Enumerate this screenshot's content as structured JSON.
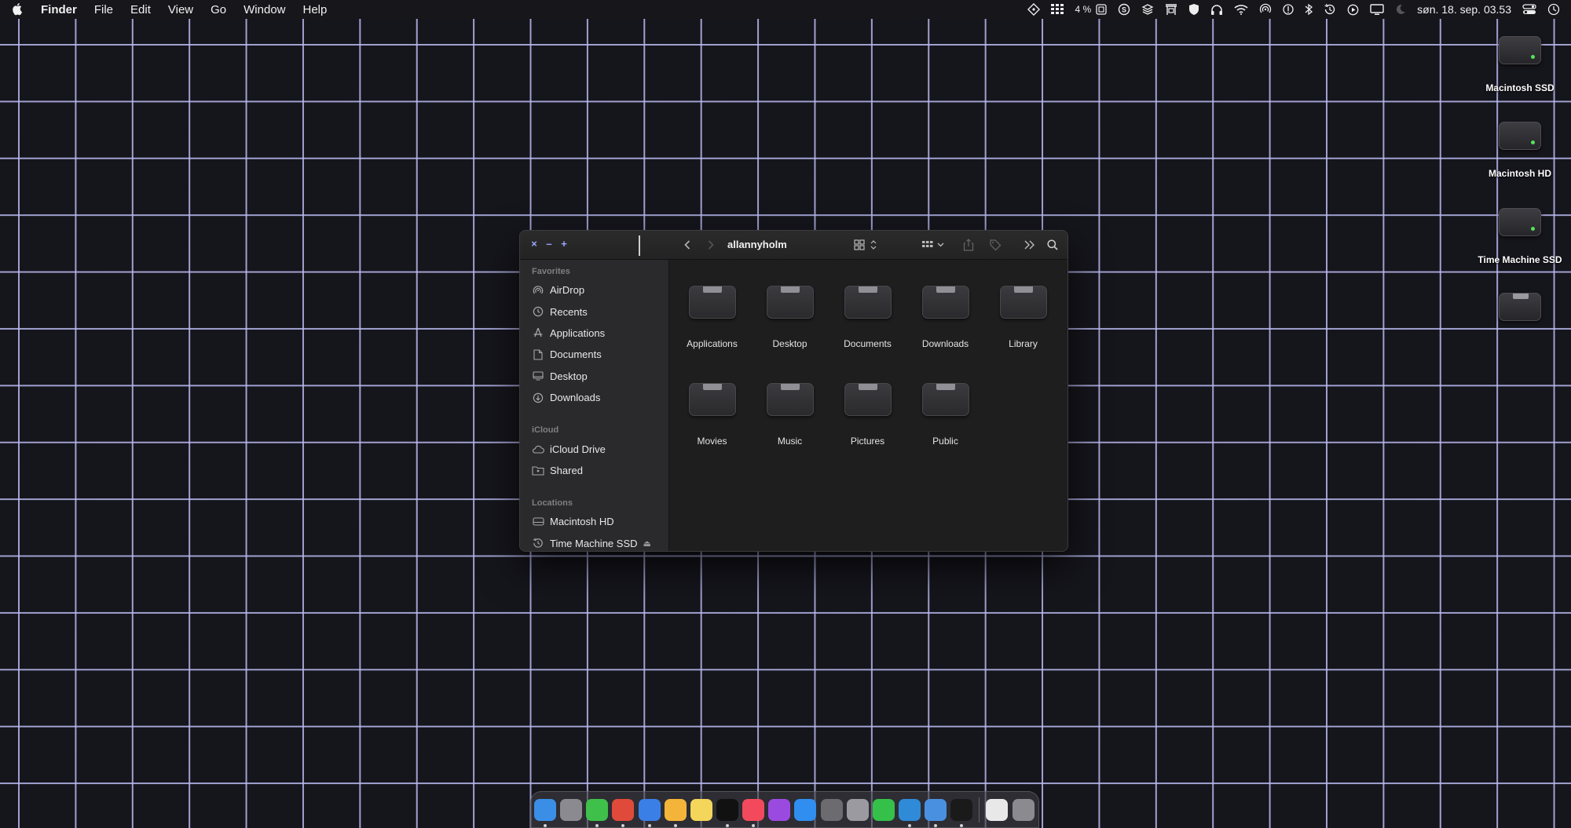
{
  "menubar": {
    "app_name": "Finder",
    "menus": [
      "File",
      "Edit",
      "View",
      "Go",
      "Window",
      "Help"
    ],
    "cpu_percent": "4 %",
    "datetime": "søn. 18. sep.  03.53",
    "status_icons": [
      "dashboard-icon",
      "grid-icon",
      "cpu-icon",
      "skype-icon",
      "layers-icon",
      "parking-icon",
      "shield-icon",
      "headphones-icon",
      "wifi-icon",
      "airdrop-icon",
      "info-icon",
      "bluetooth-icon",
      "time-machine-icon",
      "play-icon",
      "display-icon",
      "moon-icon",
      "control-center-icon",
      "clock-icon"
    ]
  },
  "desktop": {
    "drives": [
      {
        "label": "Macintosh SSD",
        "icon": "external-drive-icon"
      },
      {
        "label": "Macintosh HD",
        "icon": "external-drive-icon"
      },
      {
        "label": "Time Machine SSD",
        "icon": "external-drive-icon"
      },
      {
        "label": "",
        "icon": "folder-drive-icon"
      }
    ]
  },
  "window": {
    "title": "allannyholm",
    "controls": {
      "close": "×",
      "minimize": "–",
      "zoom": "+"
    },
    "sidebar": {
      "sections": [
        {
          "header": "Favorites",
          "items": [
            {
              "label": "AirDrop",
              "icon": "airdrop-icon"
            },
            {
              "label": "Recents",
              "icon": "clock-icon"
            },
            {
              "label": "Applications",
              "icon": "applications-icon"
            },
            {
              "label": "Documents",
              "icon": "document-icon"
            },
            {
              "label": "Desktop",
              "icon": "desktop-icon"
            },
            {
              "label": "Downloads",
              "icon": "download-icon"
            }
          ]
        },
        {
          "header": "iCloud",
          "items": [
            {
              "label": "iCloud Drive",
              "icon": "cloud-icon"
            },
            {
              "label": "Shared",
              "icon": "shared-folder-icon"
            }
          ]
        },
        {
          "header": "Locations",
          "items": [
            {
              "label": "Macintosh HD",
              "icon": "disk-icon"
            },
            {
              "label": "Time Machine SSD",
              "icon": "time-machine-icon",
              "eject": "⏏"
            }
          ]
        }
      ]
    },
    "folders": [
      "Applications",
      "Desktop",
      "Documents",
      "Downloads",
      "Library",
      "Movies",
      "Music",
      "Pictures",
      "Public"
    ]
  },
  "dock": {
    "apps": [
      {
        "name": "finder-icon",
        "color": "#3a8ee6"
      },
      {
        "name": "launchpad-icon",
        "color": "#8a8a90"
      },
      {
        "name": "messages-icon",
        "color": "#3fc04a"
      },
      {
        "name": "chrome-icon",
        "color": "#e04a3a"
      },
      {
        "name": "mail-icon",
        "color": "#3a7fe6"
      },
      {
        "name": "sketch-icon",
        "color": "#f4b43a"
      },
      {
        "name": "notes-icon",
        "color": "#f3d65a"
      },
      {
        "name": "apple-tv-icon",
        "color": "#111111"
      },
      {
        "name": "music-icon",
        "color": "#f24a5c"
      },
      {
        "name": "podcasts-icon",
        "color": "#9b4ae0"
      },
      {
        "name": "app-store-icon",
        "color": "#2f8ef0"
      },
      {
        "name": "system-preferences-icon",
        "color": "#6b6b70"
      },
      {
        "name": "automator-icon",
        "color": "#9a9aa0"
      },
      {
        "name": "tower-icon",
        "color": "#35c04a"
      },
      {
        "name": "skype-icon",
        "color": "#2f8ad8"
      },
      {
        "name": "screen-sharing-icon",
        "color": "#4a90e0"
      },
      {
        "name": "terminal-icon",
        "color": "#1a1a1a"
      },
      {
        "name": "preview-icon",
        "color": "#e8e8e8"
      },
      {
        "name": "trash-icon",
        "color": "#8a8a8f"
      }
    ]
  }
}
